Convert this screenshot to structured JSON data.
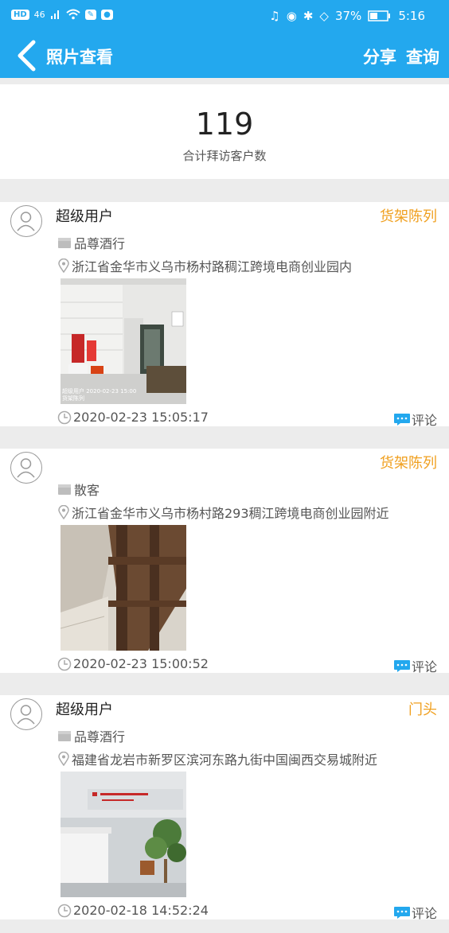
{
  "status_bar": {
    "left_chips": [
      "HD",
      "46"
    ],
    "battery": "37%",
    "time": "5:16"
  },
  "nav": {
    "title": "照片查看",
    "share": "分享",
    "query": "查询"
  },
  "summary": {
    "count": "119",
    "label": "合计拜访客户数"
  },
  "cards": [
    {
      "user": "超级用户",
      "tag": "货架陈列",
      "store": "品尊酒行",
      "address": "浙江省金华市义乌市杨村路稠江跨境电商创业园内",
      "photo_caption_1": "超级用户  2020-02-23 15:00",
      "photo_caption_2": "货架陈列",
      "time": "2020-02-23 15:05:17",
      "comment": "评论"
    },
    {
      "user": "",
      "tag": "货架陈列",
      "store": "散客",
      "address": "浙江省金华市义乌市杨村路293稠江跨境电商创业园附近",
      "time": "2020-02-23 15:00:52",
      "comment": "评论"
    },
    {
      "user": "超级用户",
      "tag": "门头",
      "store": "品尊酒行",
      "address": "福建省龙岩市新罗区滨河东路九街中国闽西交易城附近",
      "time": "2020-02-18 14:52:24",
      "comment": "评论"
    }
  ],
  "colors": {
    "primary": "#23a8ee",
    "tag": "#f0a020",
    "comment_icon": "#23a8ee"
  }
}
